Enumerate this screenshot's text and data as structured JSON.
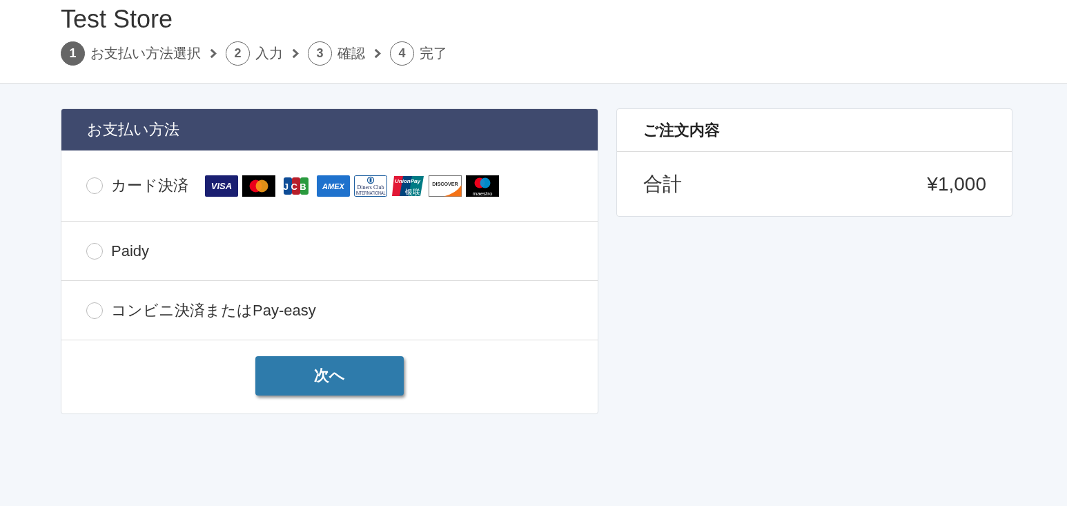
{
  "header": {
    "store_name": "Test Store",
    "steps": [
      {
        "number": "1",
        "label": "お支払い方法選択",
        "selected": true
      },
      {
        "number": "2",
        "label": "入力",
        "selected": false
      },
      {
        "number": "3",
        "label": "確認",
        "selected": false
      },
      {
        "number": "4",
        "label": "完了",
        "selected": false
      }
    ]
  },
  "payment": {
    "title": "お支払い方法",
    "methods": [
      {
        "label": "カード決済",
        "selected": false,
        "logos": [
          {
            "kind": "visa",
            "label": "VISA"
          },
          {
            "kind": "mastercard"
          },
          {
            "kind": "jcb",
            "label": "JCB"
          },
          {
            "kind": "amex",
            "label": "AMEX"
          },
          {
            "kind": "diners",
            "label": "Diners Club",
            "sublabel": "INTERNATIONAL"
          },
          {
            "kind": "unionpay",
            "label": "UnionPay",
            "sublabel": "银联"
          },
          {
            "kind": "discover",
            "label": "DISCOVER"
          },
          {
            "kind": "maestro",
            "label": "maestro"
          }
        ]
      },
      {
        "label": "Paidy",
        "selected": false
      },
      {
        "label": "コンビニ決済またはPay-easy",
        "selected": false
      }
    ],
    "next_button": "次へ"
  },
  "order_summary": {
    "title": "ご注文内容",
    "total_label": "合計",
    "total_value": "¥1,000"
  }
}
